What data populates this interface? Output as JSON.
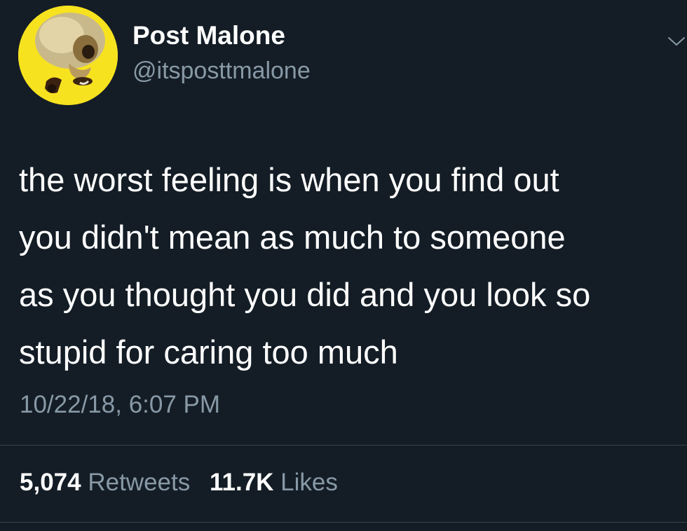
{
  "tweet": {
    "author": {
      "display_name": "Post Malone",
      "handle": "@itsposttmalone",
      "avatar_bg": "#f7e21f"
    },
    "text_lines": [
      "the worst feeling is when you find out",
      "you didn't mean as much to someone",
      "as you thought you did and you look so",
      "stupid for caring too much"
    ],
    "timestamp": "10/22/18, 6:07 PM",
    "stats": {
      "retweets": {
        "count": "5,074",
        "label": "Retweets"
      },
      "likes": {
        "count": "11.7K",
        "label": "Likes"
      }
    },
    "menu_icon": "chevron-down-icon"
  },
  "colors": {
    "background": "#141d26",
    "primary_text": "#ffffff",
    "secondary_text": "#8899a6",
    "divider": "#38444d"
  }
}
